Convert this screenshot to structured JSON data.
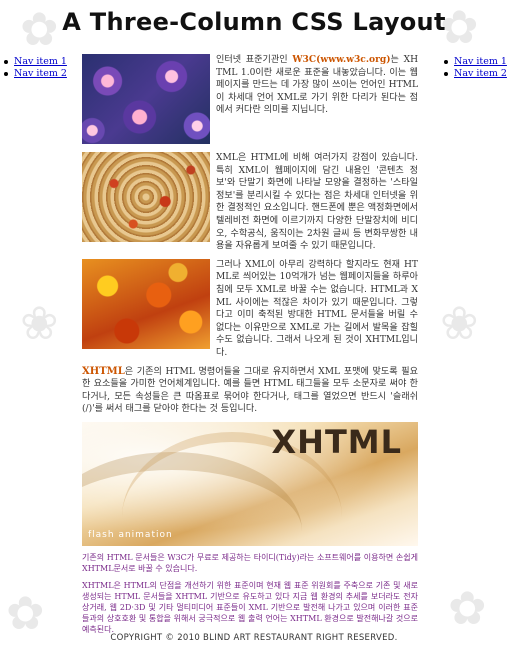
{
  "header": {
    "title": "A Three-Column CSS Layout"
  },
  "nav_left": [
    {
      "label": "Nav item 1"
    },
    {
      "label": "Nav item 2"
    }
  ],
  "nav_right": [
    {
      "label": "Nav item 1"
    },
    {
      "label": "Nav item 2"
    }
  ],
  "content": {
    "para1_pre": "인터넷 표준기관인 ",
    "para1_link": "W3C(www.w3c.org)",
    "para1_post": "는 XHTML 1.0이란 새로운 표준을 내놓았습니다. 이는 웹페이지를 만드는 데 가장 많이 쓰이는 언어인 HTML이 차세대 언어 XML로 가기 위한 다리가 된다는 점에서 커다란 의미를 지닙니다.",
    "para2": "XML은 HTML에 비해 여러가지 강점이 있습니다. 특히 XML이 웹페이지에 담긴 내용인 '콘텐츠 정보'와 단말기 화면에 나타날 모양을 결정하는 '스타일 정보'를 분리시킬 수 있다는 점은 차세대 인터넷을 위한 결정적인 요소입니다. 핸드폰에 뿐은 액정화면에서 텔레비전 화면에 이르기까지 다양한 단말장치에 비디오, 수학공식, 움직이는 2차원 글씨 등 변화무쌍한 내용을 자유롭게 보여줄 수 있기 때문입니다.",
    "para3": "그러나 XML이 아무리 강력하다 할지라도 현재 HTML로 씌어있는 10억개가 넘는 웹페이지들을 하루아침에 모두 XML로 바꿀 수는 없습니다. HTML과 XML 사이에는 적잖은 차이가 있기 때문입니다. 그렇다고 이미 축적된 방대한 HTML 문서들을 버릴 수 없다는 이유만으로 XML로 가는 길에서 발목을 잡힐 수도 없습니다. 그래서 나오게 된 것이 XHTML입니다.",
    "para4_lead": "XHTML",
    "para4_rest": "은 기존의 HTML 명령어들을 그대로 유지하면서 XML 포맷에 맞도록 필요한 요소들을 가미한 언어체계입니다. 예를 들면 HTML 태그들을 모두 소문자로 써야 한다거나, 모든 속성들은 큰 따옴표로 묶어야 한다거나, 태그를 열었으면 반드시 '슬래쉬(/)'를 써서 태그를 닫아야 한다는 것 등입니다.",
    "banner_title": "XHTML",
    "banner_sub": "flash animation",
    "purple1": "기존의 HTML 문서들은 W3C가 무료로 제공하는 타이디(Tidy)라는 소프트웨어를 이용하면 손쉽게 XHTML문서로 바꿀 수 있습니다.",
    "purple2": "XHTML은 HTML의 단점을 개선하기 위한 표준이며 현재 웹 표준 위원회를 주축으로 기존 및 새로 생성되는 HTML 문서들을 XHTML 기반으로 유도하고 있다 지금 웹 환경의 추세를 보더라도 전자상거래, 웹 2D·3D 및 기타 멀티미디어 표준들이 XML 기반으로 발전해 나가고 있으며 이러한 표준들과의 상호호환 및 통합을 위해서 궁극적으로 웹 출력 언어는 XHTML 환경으로 발전해나갈 것으로 예측된다."
  },
  "footer": {
    "text": "COPYRIGHT © 2010 BLIND ART RESTAURANT RIGHT RESERVED."
  }
}
